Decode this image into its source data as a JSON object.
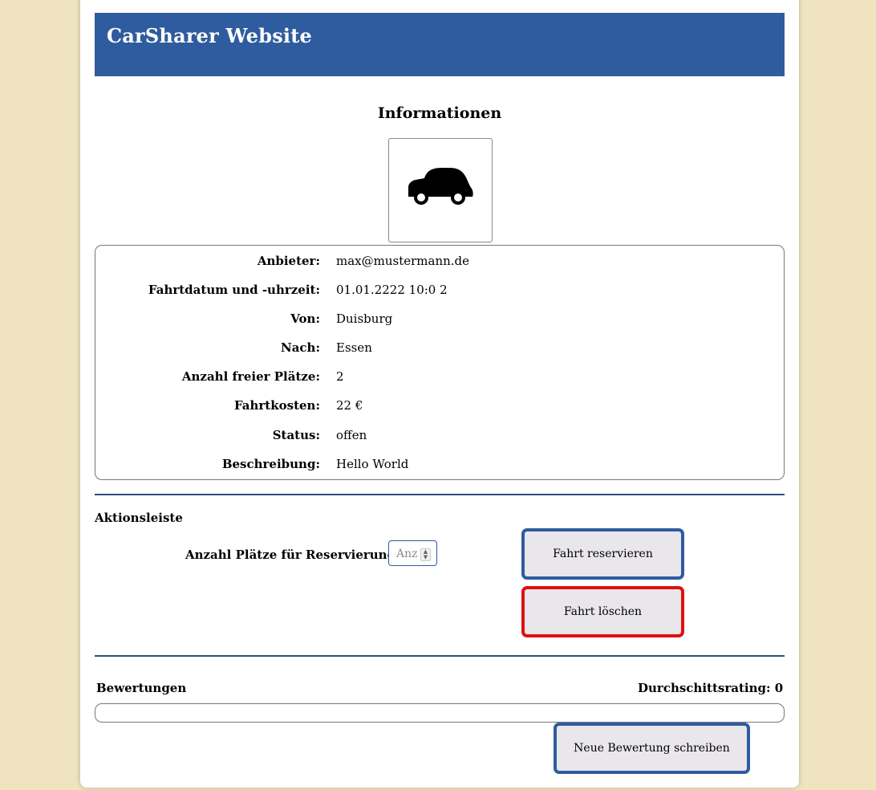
{
  "header": {
    "title": "CarSharer Website"
  },
  "info": {
    "title": "Informationen",
    "image_icon": "car-icon",
    "rows": [
      {
        "label": "Anbieter:",
        "value": "max@mustermann.de"
      },
      {
        "label": "Fahrtdatum und -uhrzeit:",
        "value": "01.01.2222 10:0 2"
      },
      {
        "label": "Von:",
        "value": "Duisburg"
      },
      {
        "label": "Nach:",
        "value": "Essen"
      },
      {
        "label": "Anzahl freier Plätze:",
        "value": "2"
      },
      {
        "label": "Fahrtkosten:",
        "value": "22 €"
      },
      {
        "label": "Status:",
        "value": "offen"
      },
      {
        "label": "Beschreibung:",
        "value": "Hello World"
      }
    ]
  },
  "actions": {
    "title": "Aktionsleiste",
    "reservation_label": "Anzahl Plätze für Reservierung:",
    "reservation_placeholder": "Anz",
    "reserve_button": "Fahrt reservieren",
    "delete_button": "Fahrt löschen"
  },
  "ratings": {
    "title": "Bewertungen",
    "average_label": "Durchschittsrating: 0",
    "new_review_button": "Neue Bewertung schreiben"
  },
  "colors": {
    "background": "#f0e4c0",
    "header": "#2e5c9e",
    "primary_border": "#2e5c9e",
    "danger_border": "#e01010"
  }
}
